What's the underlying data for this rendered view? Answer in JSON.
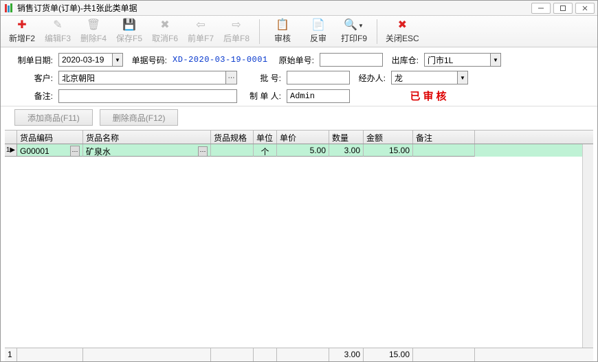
{
  "window": {
    "title": "销售订货单(订单)-共1张此类单据"
  },
  "toolbar": {
    "new": "新增F2",
    "edit": "编辑F3",
    "delete": "删除F4",
    "save": "保存F5",
    "cancel": "取消F6",
    "prev": "前单F7",
    "next": "后单F8",
    "audit": "审核",
    "unaudit": "反审",
    "print": "打印F9",
    "close": "关闭ESC"
  },
  "form": {
    "date_label": "制单日期:",
    "date_value": "2020-03-19",
    "docnum_label": "单据号码:",
    "docnum_value": "XD-2020-03-19-0001",
    "origdoc_label": "原始单号:",
    "origdoc_value": "",
    "warehouse_label": "出库仓:",
    "warehouse_value": "门市1L",
    "customer_label": "客户:",
    "customer_value": "北京朝阳",
    "batch_label": "批     号:",
    "batch_value": "",
    "handler_label": "经办人:",
    "handler_value": "龙",
    "remark_label": "备注:",
    "remark_value": "",
    "maker_label": "制 单 人:",
    "maker_value": "Admin",
    "approved_stamp": "已审核"
  },
  "buttons": {
    "add_item": "添加商品(F11)",
    "del_item": "删除商品(F12)"
  },
  "grid": {
    "headers": {
      "code": "货品编码",
      "name": "货品名称",
      "spec": "货品规格",
      "unit": "单位",
      "price": "单价",
      "qty": "数量",
      "amount": "金额",
      "remark": "备注"
    },
    "rows": [
      {
        "idx": "1",
        "marker": "▶",
        "code": "G00001",
        "name": "矿泉水",
        "spec": "",
        "unit": "个",
        "price": "5.00",
        "qty": "3.00",
        "amount": "15.00",
        "remark": ""
      }
    ],
    "footer": {
      "idx": "1",
      "qty": "3.00",
      "amount": "15.00"
    }
  }
}
